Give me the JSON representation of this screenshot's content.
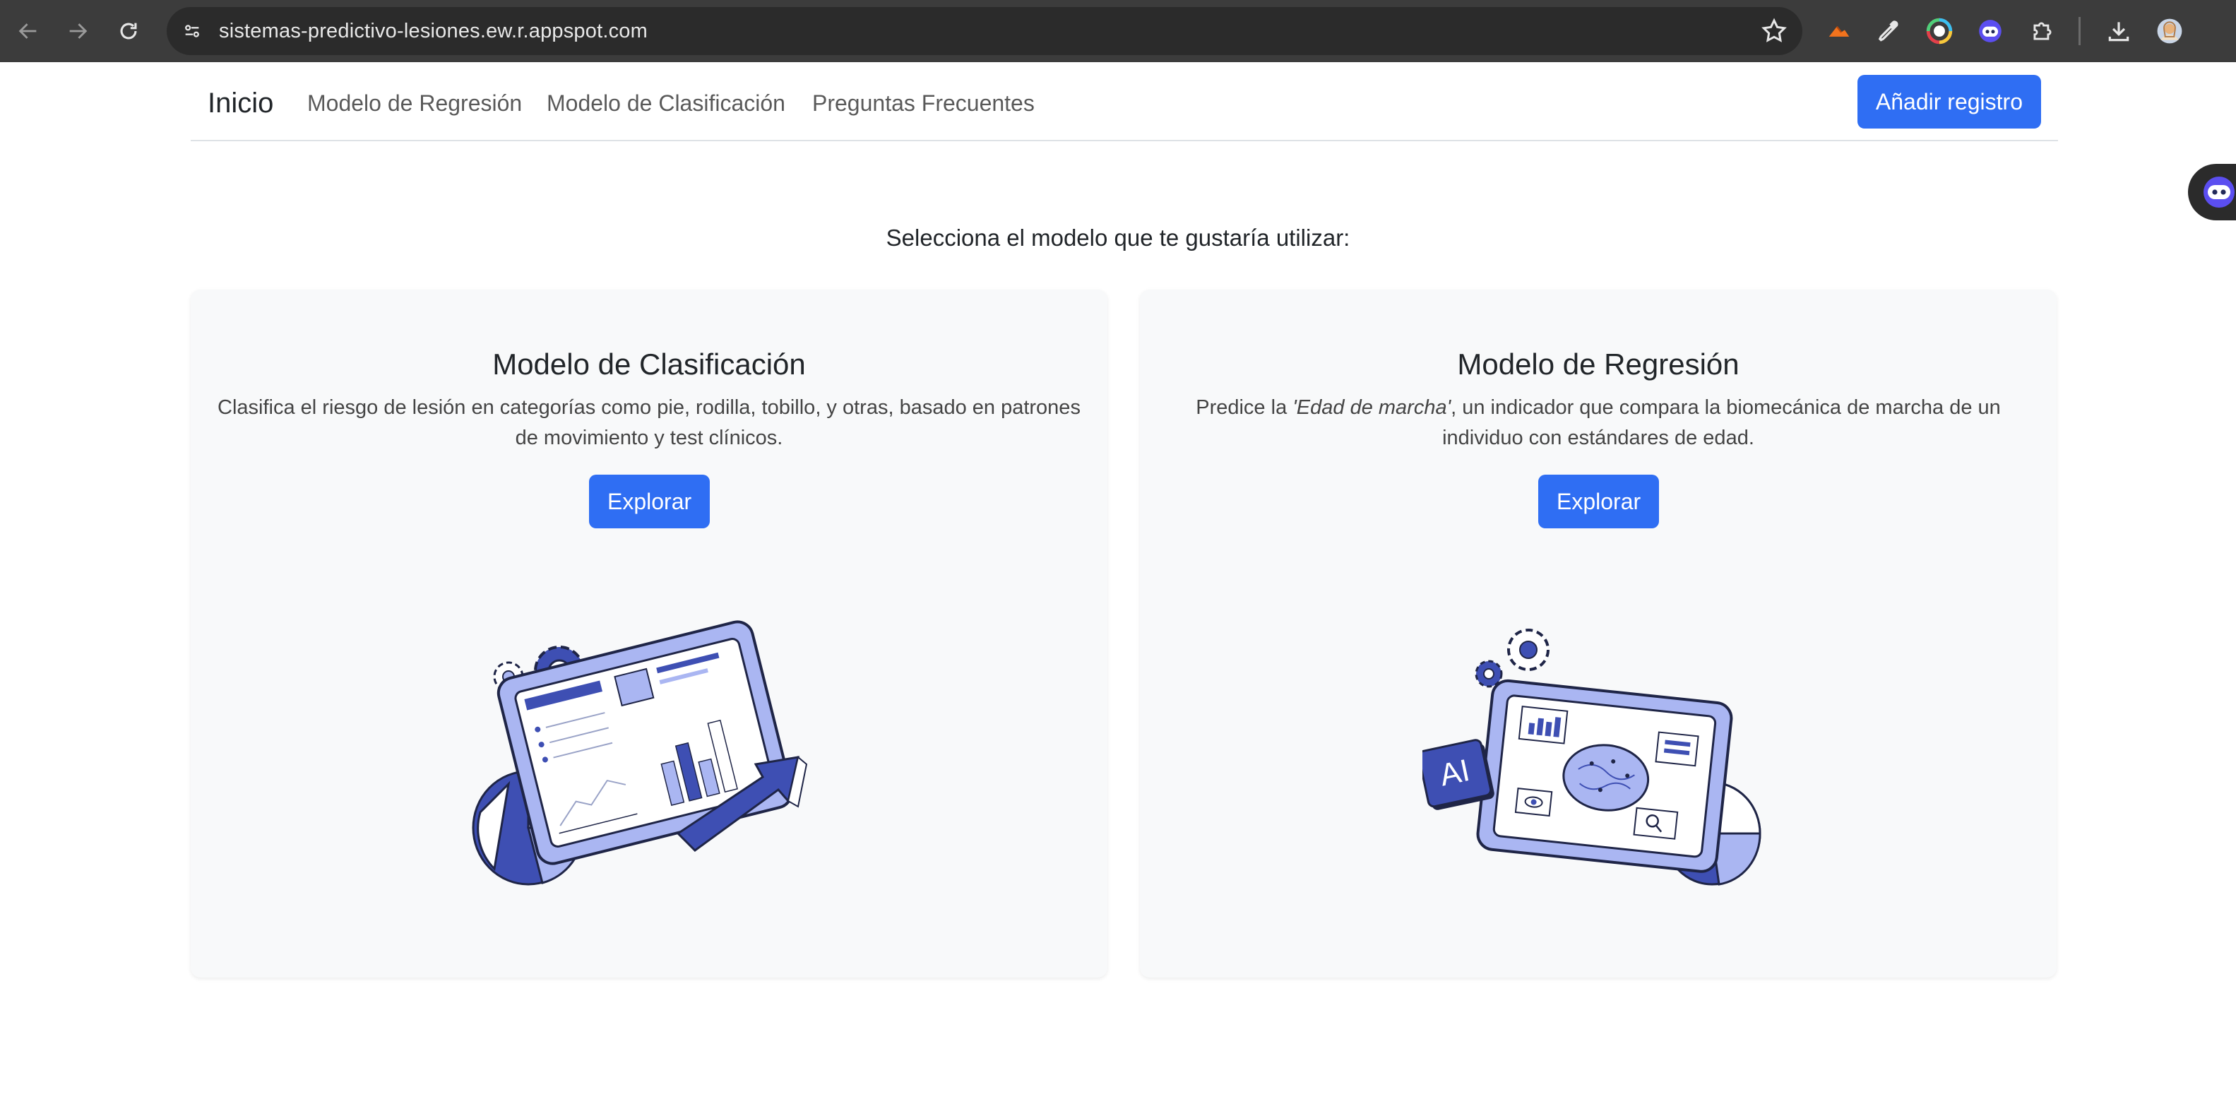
{
  "browser": {
    "url": "sistemas-predictivo-lesiones.ew.r.appspot.com",
    "icons": [
      "back-arrow-icon",
      "forward-arrow-icon",
      "reload-icon",
      "site-info-icon",
      "bookmark-star-icon",
      "extension-icon",
      "eyedropper-icon",
      "color-wheel-icon",
      "robot-face-icon",
      "puzzle-icon",
      "download-icon",
      "profile-avatar"
    ]
  },
  "navbar": {
    "brand": "Inicio",
    "links": [
      "Modelo de Regresión",
      "Modelo de Clasificación",
      "Preguntas Frecuentes"
    ],
    "add_button": "Añadir registro"
  },
  "main": {
    "prompt": "Selecciona el modelo que te gustaría utilizar:",
    "cards": [
      {
        "title": "Modelo de Clasificación",
        "description": "Clasifica el riesgo de lesión en categorías como pie, rodilla, tobillo, y otras, basado en patrones de movimiento y test clínicos.",
        "button": "Explorar"
      },
      {
        "title": "Modelo de Regresión",
        "description_before": "Predice la ",
        "description_italic": "'Edad de marcha'",
        "description_after": ", un indicador que compara la biomecánica de marcha de un individuo con estándares de edad.",
        "button": "Explorar",
        "illustration_label": "AI"
      }
    ]
  },
  "colors": {
    "primary": "#2f6ef3",
    "illustration_dark": "#3e4fb3",
    "illustration_light": "#aab6f2",
    "card_bg": "#f8f9fa",
    "chrome_bg": "#3c3c3c"
  }
}
